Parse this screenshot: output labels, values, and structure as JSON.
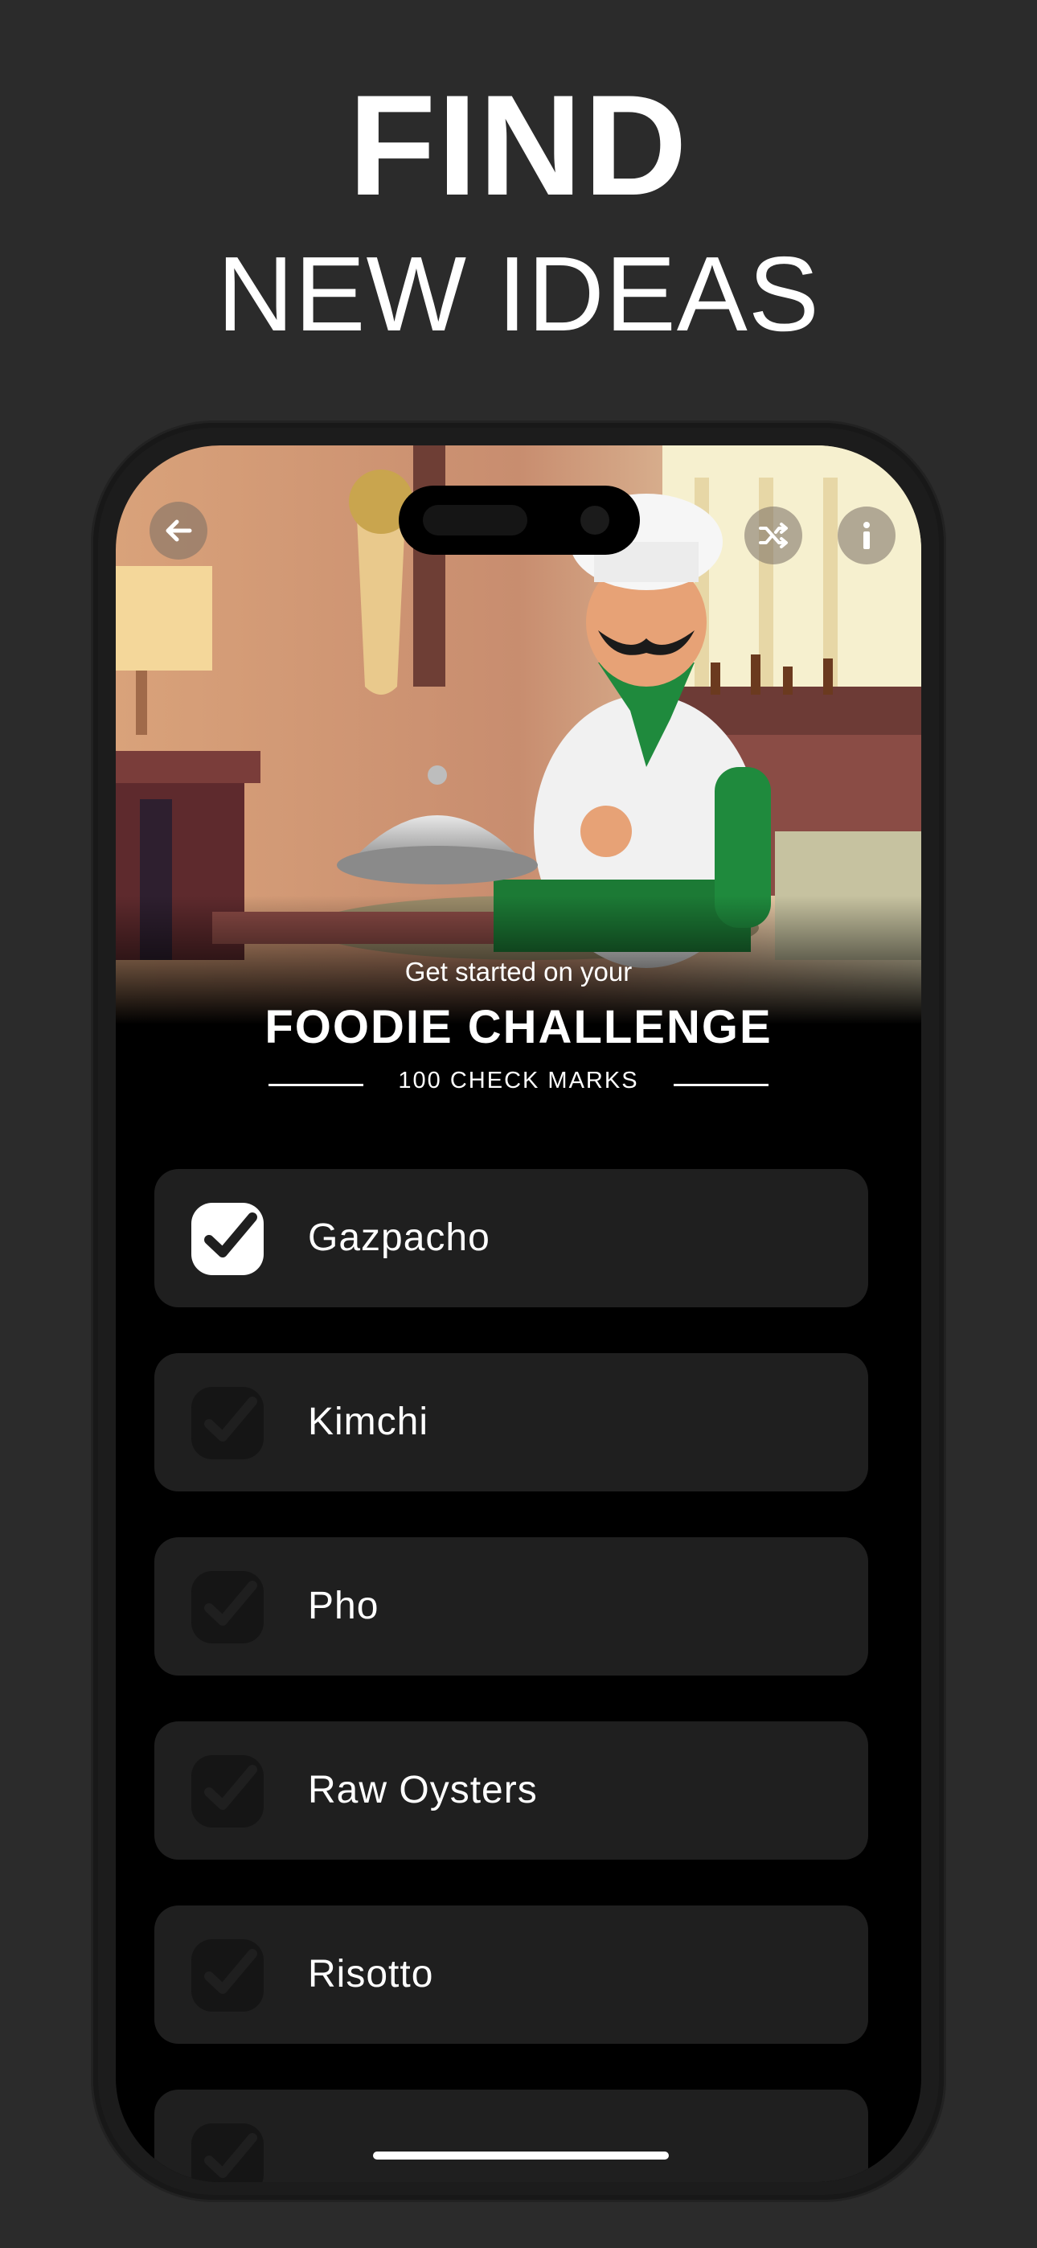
{
  "promo": {
    "line1": "FIND",
    "line2": "NEW IDEAS"
  },
  "app": {
    "icons": {
      "back": "arrow-left-icon",
      "shuffle": "shuffle-icon",
      "info": "info-icon"
    },
    "intro": {
      "subtitle": "Get started on your",
      "title": "FOODIE CHALLENGE",
      "count": "100 CHECK MARKS"
    },
    "items": [
      {
        "label": "Gazpacho",
        "checked": true
      },
      {
        "label": "Kimchi",
        "checked": false
      },
      {
        "label": "Pho",
        "checked": false
      },
      {
        "label": "Raw Oysters",
        "checked": false
      },
      {
        "label": "Risotto",
        "checked": false
      }
    ],
    "colors": {
      "background": "#2b2b2b",
      "card": "#1f1f1f",
      "checked": "#ffffff",
      "unchecked": "#151515"
    }
  }
}
